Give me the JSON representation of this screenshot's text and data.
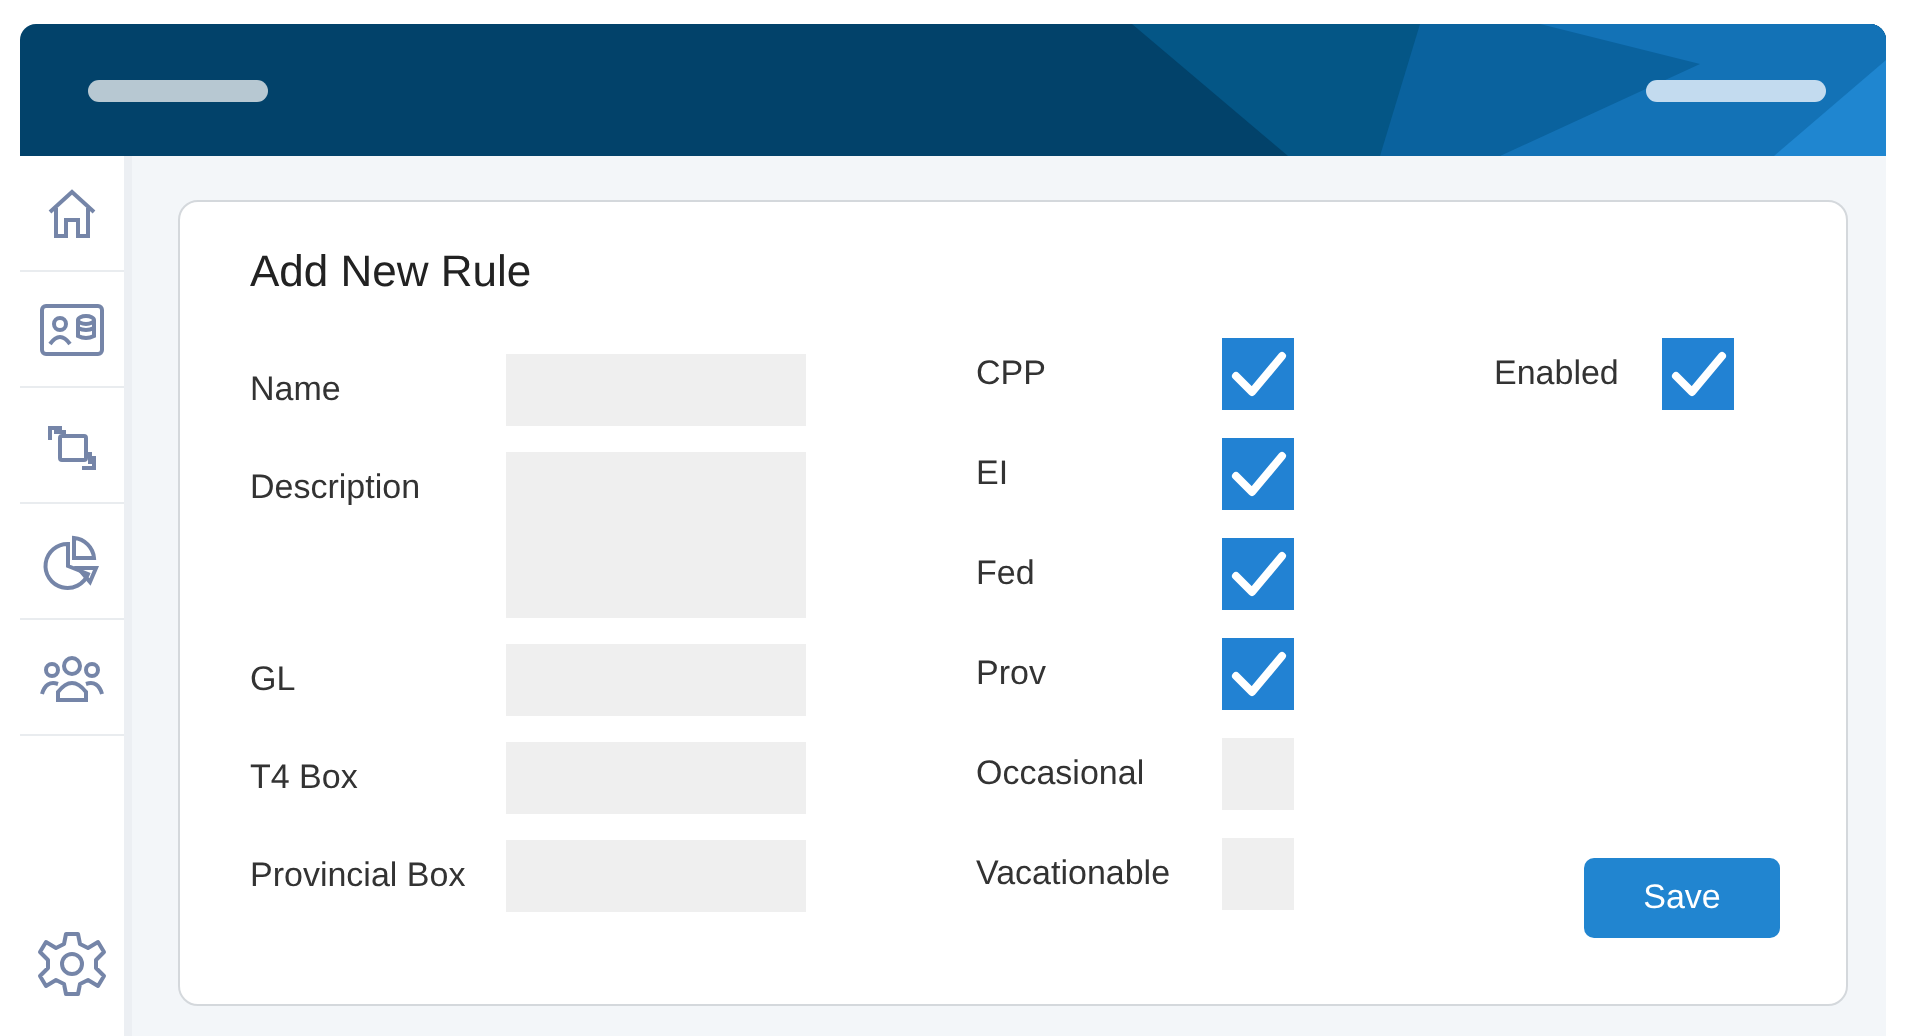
{
  "title": "Add New Rule",
  "fields": [
    {
      "label": "Name",
      "kind": "text"
    },
    {
      "label": "Description",
      "kind": "textarea"
    },
    {
      "label": "GL",
      "kind": "text"
    },
    {
      "label": "T4 Box",
      "kind": "text"
    },
    {
      "label": "Provincial Box",
      "kind": "text"
    }
  ],
  "flags": [
    {
      "label": "CPP",
      "checked": true
    },
    {
      "label": "EI",
      "checked": true
    },
    {
      "label": "Fed",
      "checked": true
    },
    {
      "label": "Prov",
      "checked": true
    },
    {
      "label": "Occasional",
      "checked": false
    },
    {
      "label": "Vacationable",
      "checked": false
    }
  ],
  "enabled": {
    "label": "Enabled",
    "checked": true
  },
  "buttons": [
    {
      "label": "Save"
    }
  ]
}
